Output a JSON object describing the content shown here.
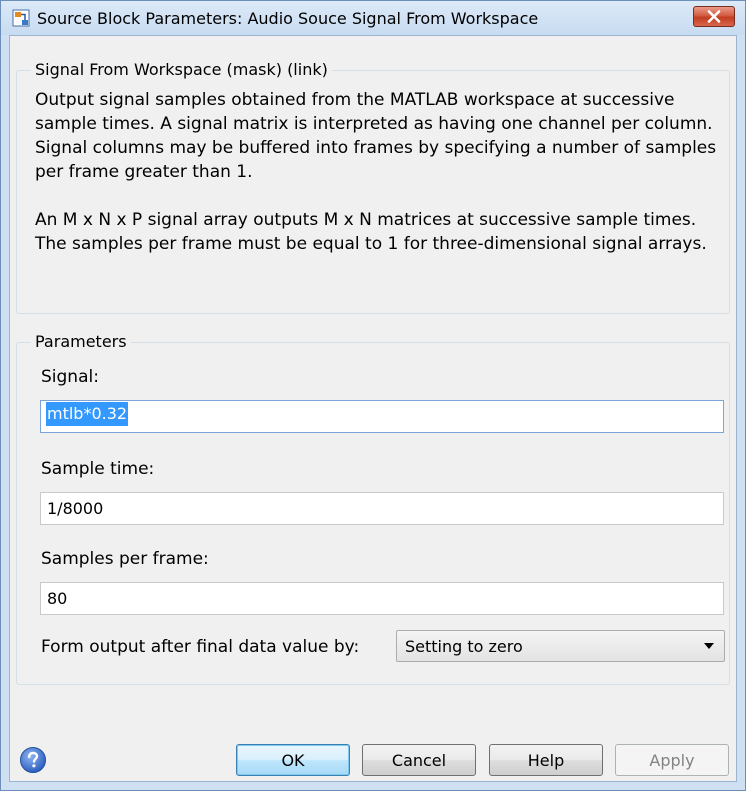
{
  "window": {
    "title": "Source Block Parameters: Audio Souce Signal From Workspace"
  },
  "description_group": {
    "title": "Signal From Workspace (mask) (link)",
    "paragraph1": "Output signal samples obtained from the MATLAB workspace at successive sample times.  A signal matrix is interpreted as having one channel per column.  Signal columns may be buffered into frames by specifying a number of samples per frame greater than 1.",
    "paragraph2": "An M x N x P signal array outputs M x N matrices at successive sample times.  The samples per frame must be equal to 1 for three-dimensional signal arrays."
  },
  "parameters": {
    "title": "Parameters",
    "signal": {
      "label": "Signal:",
      "value": "mtlb*0.32"
    },
    "sample_time": {
      "label": "Sample time:",
      "value": "1/8000"
    },
    "samples_per_frame": {
      "label": "Samples per frame:",
      "value": "80"
    },
    "form_output": {
      "label": "Form output after final data value by:",
      "selected": "Setting to zero"
    }
  },
  "buttons": {
    "ok": "OK",
    "cancel": "Cancel",
    "help": "Help",
    "apply": "Apply"
  },
  "colors": {
    "selection": "#3399ff",
    "titlebar": "#c7dbf1",
    "close_button": "#c23e22",
    "dialog_background": "#f0f0f0"
  },
  "icons": {
    "window": "simulink-block-icon",
    "close": "close-icon",
    "help": "help-question-icon",
    "dropdown": "chevron-down-icon"
  }
}
